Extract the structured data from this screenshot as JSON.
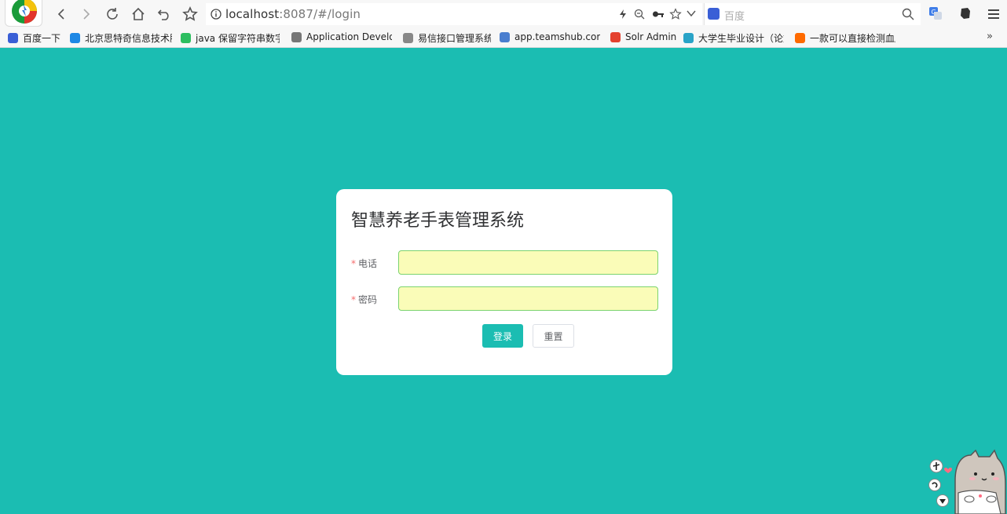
{
  "browser": {
    "url_host": "localhost",
    "url_rest": ":8087/#/login",
    "search_placeholder": "百度"
  },
  "bookmarks": [
    {
      "label": "百度一下",
      "icon": "paw-icon",
      "color": "#3a5fd6"
    },
    {
      "label": "北京思特奇信息技术股",
      "icon": "cloud-icon",
      "color": "#1e88e5"
    },
    {
      "label": "java 保留字符串数字",
      "icon": "evernote-icon",
      "color": "#2dbe60"
    },
    {
      "label": "Application Develop",
      "icon": "image-icon",
      "color": "#777777"
    },
    {
      "label": "易信接口管理系统",
      "icon": "page-icon",
      "color": "#888888"
    },
    {
      "label": "app.teamshub.com/",
      "icon": "image-icon",
      "color": "#4a7ecf"
    },
    {
      "label": "Solr Admin",
      "icon": "solr-icon",
      "color": "#e4412f"
    },
    {
      "label": "大学生毕业设计（论文",
      "icon": "graduate-icon",
      "color": "#29a3c7"
    },
    {
      "label": "一款可以直接检测血压",
      "icon": "shop-icon",
      "color": "#ff6a00"
    }
  ],
  "login": {
    "title": "智慧养老手表管理系统",
    "phone_label": "电话",
    "password_label": "密码",
    "required_mark": "*",
    "login_button": "登录",
    "reset_button": "重置",
    "phone_value": "",
    "password_value": ""
  },
  "colors": {
    "page_bg": "#1bbdb2",
    "primary": "#1bbdb2",
    "input_autofill": "#fafcb8",
    "input_border": "#7bd36f",
    "required": "#f56c6c"
  }
}
